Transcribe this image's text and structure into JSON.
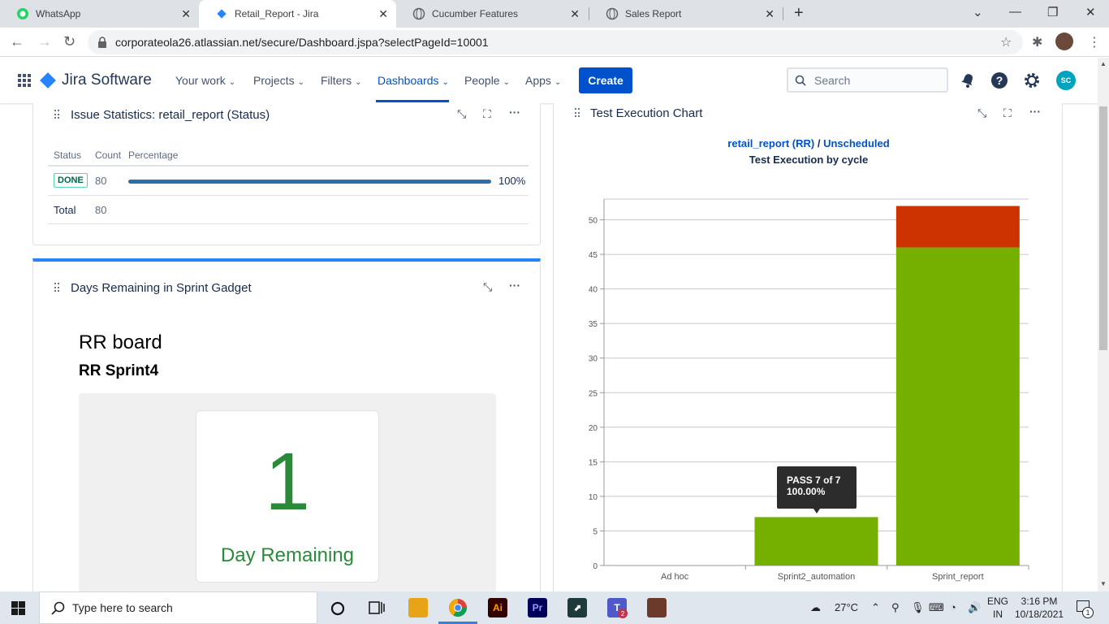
{
  "browser": {
    "tabs": [
      {
        "title": "WhatsApp",
        "icon": "whatsapp-icon"
      },
      {
        "title": "Retail_Report - Jira",
        "icon": "jira-icon",
        "active": true
      },
      {
        "title": "Cucumber Features",
        "icon": "globe-icon"
      },
      {
        "title": "Sales Report",
        "icon": "globe-icon"
      }
    ],
    "url": "corporateola26.atlassian.net/secure/Dashboard.jspa?selectPageId=10001"
  },
  "jira": {
    "product": "Jira Software",
    "nav": [
      {
        "label": "Your work"
      },
      {
        "label": "Projects"
      },
      {
        "label": "Filters"
      },
      {
        "label": "Dashboards"
      },
      {
        "label": "People"
      },
      {
        "label": "Apps"
      }
    ],
    "create_label": "Create",
    "search_placeholder": "Search",
    "avatar_initials": "SC"
  },
  "issue_stats": {
    "title": "Issue Statistics: retail_report (Status)",
    "headers": {
      "status": "Status",
      "count": "Count",
      "percentage": "Percentage"
    },
    "rows": [
      {
        "status": "DONE",
        "count": "80",
        "percentage": "100%",
        "fraction": 1.0
      }
    ],
    "total_label": "Total",
    "total_value": "80"
  },
  "days_remaining": {
    "title": "Days Remaining in Sprint Gadget",
    "board": "RR board",
    "sprint": "RR Sprint4",
    "days": "1",
    "label": "Day Remaining"
  },
  "test_chart": {
    "title": "Test Execution Chart",
    "project_link": "retail_report (RR)",
    "separator": "/",
    "cycle_link": "Unscheduled",
    "subtitle": "Test Execution by cycle",
    "tooltip_line1": "PASS 7 of 7",
    "tooltip_line2": "100.00%"
  },
  "chart_data": {
    "type": "bar",
    "stacked": true,
    "categories": [
      "Ad hoc",
      "Sprint2_automation",
      "Sprint_report"
    ],
    "series": [
      {
        "values": [
          0,
          7,
          46
        ],
        "color": "#75b000"
      },
      {
        "values": [
          0,
          0,
          6
        ],
        "color": "#cc3300"
      }
    ],
    "ylim": [
      0,
      53
    ],
    "yticks": [
      0,
      5,
      10,
      15,
      20,
      25,
      30,
      35,
      40,
      45,
      50
    ],
    "grid": true
  },
  "taskbar": {
    "search_placeholder": "Type here to search",
    "weather": "27°C",
    "lang1": "ENG",
    "lang2": "IN",
    "time": "3:16 PM",
    "date": "10/18/2021",
    "notification_count": "1",
    "teams_badge": "2"
  }
}
